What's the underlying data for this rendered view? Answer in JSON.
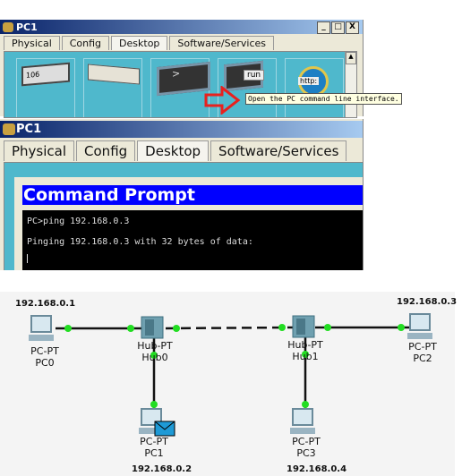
{
  "window1": {
    "title": "PC1",
    "tabs": [
      "Physical",
      "Config",
      "Desktop",
      "Software/Services"
    ],
    "active_tab": "Desktop",
    "window_buttons": [
      "_",
      "□",
      "X"
    ],
    "apps": [
      {
        "icon": "ip-configuration-icon",
        "text": "106"
      },
      {
        "icon": "dialup-modem-icon",
        "text": ""
      },
      {
        "icon": "terminal-icon",
        "text": ">"
      },
      {
        "icon": "command-prompt-icon",
        "text": "run"
      },
      {
        "icon": "web-browser-icon",
        "text": "http:"
      }
    ],
    "tooltip": "Open the PC command line interface.",
    "arrow_color": "#e8211e"
  },
  "window2": {
    "title": "PC1",
    "tabs": [
      "Physical",
      "Config",
      "Desktop",
      "Software/Services"
    ],
    "active_tab": "Desktop",
    "command_prompt": {
      "title": "Command Prompt",
      "lines": [
        "PC>ping 192.168.0.3",
        "",
        "Pinging 192.168.0.3 with 32 bytes of data:"
      ]
    }
  },
  "topology": {
    "link_light_color": "#22dd22",
    "devices": [
      {
        "id": "pc0",
        "type": "PC-PT",
        "name": "PC0",
        "ip": "192.168.0.1"
      },
      {
        "id": "hub0",
        "type": "Hub-PT",
        "name": "Hub0"
      },
      {
        "id": "hub1",
        "type": "Hub-PT",
        "name": "Hub1"
      },
      {
        "id": "pc2",
        "type": "PC-PT",
        "name": "PC2",
        "ip": "192.168.0.3"
      },
      {
        "id": "pc1",
        "type": "PC-PT",
        "name": "PC1",
        "ip": "192.168.0.2",
        "has_pdu": true
      },
      {
        "id": "pc3",
        "type": "PC-PT",
        "name": "PC3",
        "ip": "192.168.0.4"
      }
    ],
    "links": [
      [
        "pc0",
        "hub0",
        "straight"
      ],
      [
        "hub0",
        "hub1",
        "crossover-dashed"
      ],
      [
        "hub1",
        "pc2",
        "straight"
      ],
      [
        "hub0",
        "pc1",
        "straight"
      ],
      [
        "hub1",
        "pc3",
        "straight"
      ]
    ]
  }
}
